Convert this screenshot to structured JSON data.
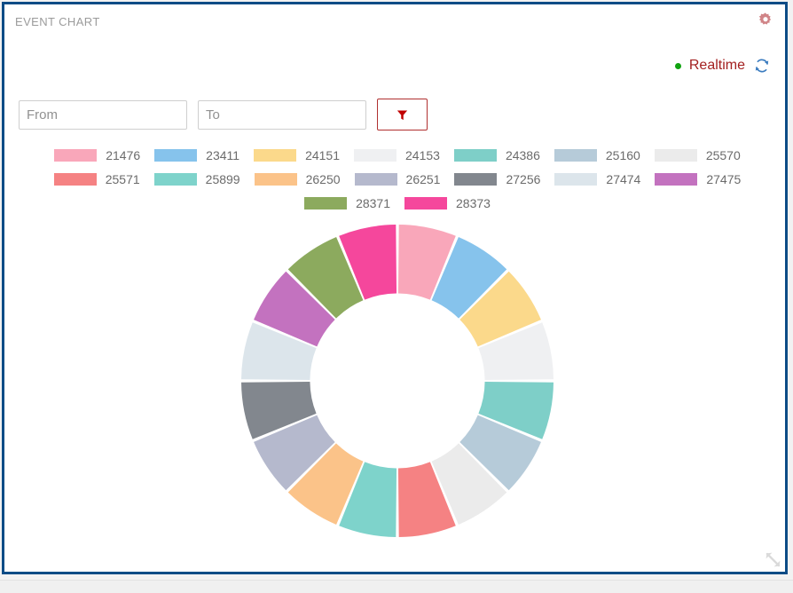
{
  "panel": {
    "title": "EVENT CHART",
    "border_color": "#0d4c86",
    "gear_icon": "gear-icon",
    "resize_icon": "resize-handle-icon"
  },
  "realtime": {
    "label": "Realtime",
    "dot_color": "#10a310",
    "text_color": "#a32020",
    "refresh_icon": "refresh-icon"
  },
  "filters": {
    "from": {
      "placeholder": "From",
      "value": ""
    },
    "to": {
      "placeholder": "To",
      "value": ""
    },
    "filter_button": {
      "icon": "funnel-icon",
      "label": "",
      "color": "#c00000"
    }
  },
  "chart_data": {
    "type": "pie",
    "title": "EVENT CHART",
    "subtype": "donut",
    "inner_radius_ratio": 0.56,
    "start_angle_deg": 0,
    "direction": "clockwise",
    "legend_position": "top",
    "grid": false,
    "xlabel": "",
    "ylabel": "",
    "categories": [
      "21476",
      "23411",
      "24151",
      "24153",
      "24386",
      "25160",
      "25570",
      "25571",
      "25899",
      "26250",
      "26251",
      "27256",
      "27474",
      "27475",
      "28371",
      "28373"
    ],
    "values": [
      1,
      1,
      1,
      1,
      1,
      1,
      1,
      1,
      1,
      1,
      1,
      1,
      1,
      1,
      1,
      1
    ],
    "percentages": [
      6.25,
      6.25,
      6.25,
      6.25,
      6.25,
      6.25,
      6.25,
      6.25,
      6.25,
      6.25,
      6.25,
      6.25,
      6.25,
      6.25,
      6.25,
      6.25
    ],
    "colors": [
      "#f9a7ba",
      "#86c3ec",
      "#fbd98b",
      "#eff0f2",
      "#7ecfc8",
      "#b6cbd9",
      "#ebebeb",
      "#f58283",
      "#7ed3cb",
      "#fbc389",
      "#b5b9cd",
      "#82878e",
      "#dce5eb",
      "#c372bf",
      "#8caa5e",
      "#f5479c"
    ],
    "legend": [
      {
        "label": "21476",
        "color": "#f9a7ba"
      },
      {
        "label": "23411",
        "color": "#86c3ec"
      },
      {
        "label": "24151",
        "color": "#fbd98b"
      },
      {
        "label": "24153",
        "color": "#eff0f2"
      },
      {
        "label": "24386",
        "color": "#7ecfc8"
      },
      {
        "label": "25160",
        "color": "#b6cbd9"
      },
      {
        "label": "25570",
        "color": "#ebebeb"
      },
      {
        "label": "25571",
        "color": "#f58283"
      },
      {
        "label": "25899",
        "color": "#7ed3cb"
      },
      {
        "label": "26250",
        "color": "#fbc389"
      },
      {
        "label": "26251",
        "color": "#b5b9cd"
      },
      {
        "label": "27256",
        "color": "#82878e"
      },
      {
        "label": "27474",
        "color": "#dce5eb"
      },
      {
        "label": "27475",
        "color": "#c372bf"
      },
      {
        "label": "28371",
        "color": "#8caa5e"
      },
      {
        "label": "28373",
        "color": "#f5479c"
      }
    ]
  }
}
